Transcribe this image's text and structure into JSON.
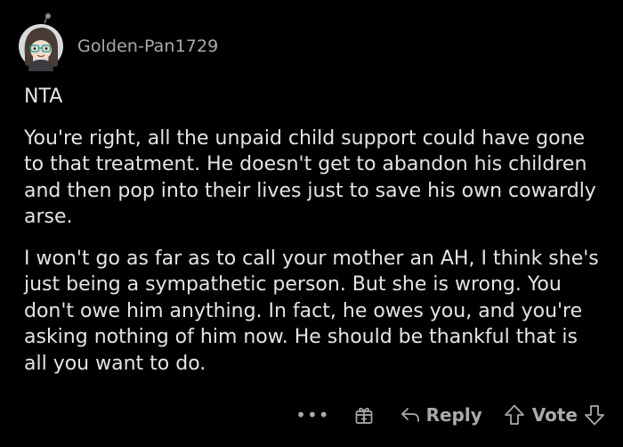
{
  "comment": {
    "username": "Golden-Pan1729",
    "paragraphs": [
      "NTA",
      "You're right, all the unpaid child support could have gone to that treatment. He doesn't get to abandon his children and then pop into their lives just to save his own cowardly arse.",
      "I won't go as far as to call your mother an AH, I think she's just being a sympathetic person. But she is wrong. You don't owe him anything. In fact, he owes you, and you're asking nothing of him now. He should be thankful that is all you want to do."
    ]
  },
  "actions": {
    "more_label": "•••",
    "reply_label": "Reply",
    "vote_label": "Vote"
  },
  "icons": {
    "more": "more-options-icon",
    "gift": "gift-award-icon",
    "reply": "reply-arrow-icon",
    "upvote": "upvote-arrow-icon",
    "downvote": "downvote-arrow-icon",
    "avatar": "snoo-avatar-icon"
  },
  "colors": {
    "background": "#000000",
    "text": "#e2e4e6",
    "muted": "#a8aaac"
  }
}
